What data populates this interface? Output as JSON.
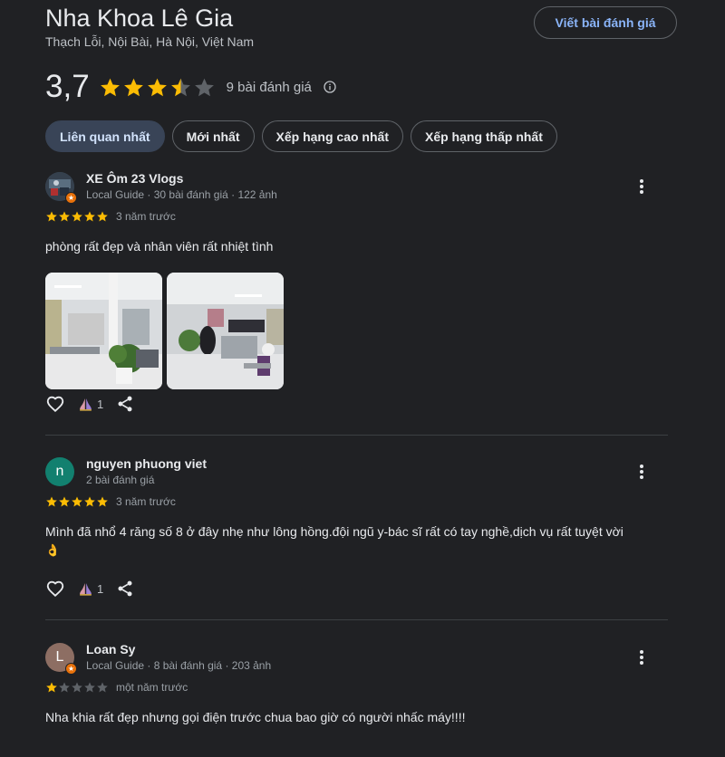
{
  "place": {
    "name": "Nha Khoa Lê Gia",
    "address": "Thạch Lỗi, Nội Bài, Hà Nội, Việt Nam",
    "rating": "3,7",
    "rating_value": 3.7,
    "review_count": "9 bài đánh giá",
    "write_review_label": "Viết bài đánh giá"
  },
  "sort_chips": [
    {
      "label": "Liên quan nhất",
      "active": true
    },
    {
      "label": "Mới nhất",
      "active": false
    },
    {
      "label": "Xếp hạng cao nhất",
      "active": false
    },
    {
      "label": "Xếp hạng thấp nhất",
      "active": false
    }
  ],
  "reviews": [
    {
      "author": "XE Ôm 23 Vlogs",
      "meta": "Local Guide · 30 bài đánh giá · 122 ảnh",
      "stars": 5,
      "time": "3 năm trước",
      "text": "phòng rất đẹp và nhân viên rất nhiệt tình",
      "reaction_count": "1",
      "photos": [
        "clinic-photo-1",
        "clinic-photo-2"
      ]
    },
    {
      "author": "nguyen phuong viet",
      "avatar_letter": "n",
      "meta": "2 bài đánh giá",
      "stars": 5,
      "time": "3 năm trước",
      "text": "Mình đã nhổ 4 răng số 8 ở đây nhẹ như lông hồng.đội ngũ y-bác sĩ rất có tay nghề,dịch vụ rất tuyệt vời",
      "emoji": "👌",
      "reaction_count": "1"
    },
    {
      "author": "Loan Sy",
      "avatar_letter": "L",
      "meta": "Local Guide · 8 bài đánh giá · 203 ảnh",
      "stars": 1,
      "time": "một năm trước",
      "text": "Nha khia rất đẹp nhưng gọi điện trước chua bao giờ có người nhấc máy!!!!"
    }
  ],
  "colors": {
    "background": "#202124",
    "star": "#fbbc04",
    "star_empty": "#5f6368",
    "link": "#8ab4f8",
    "active_chip": "#394457",
    "avatar_teal": "#12806f",
    "avatar_brown": "#8d6e63"
  }
}
